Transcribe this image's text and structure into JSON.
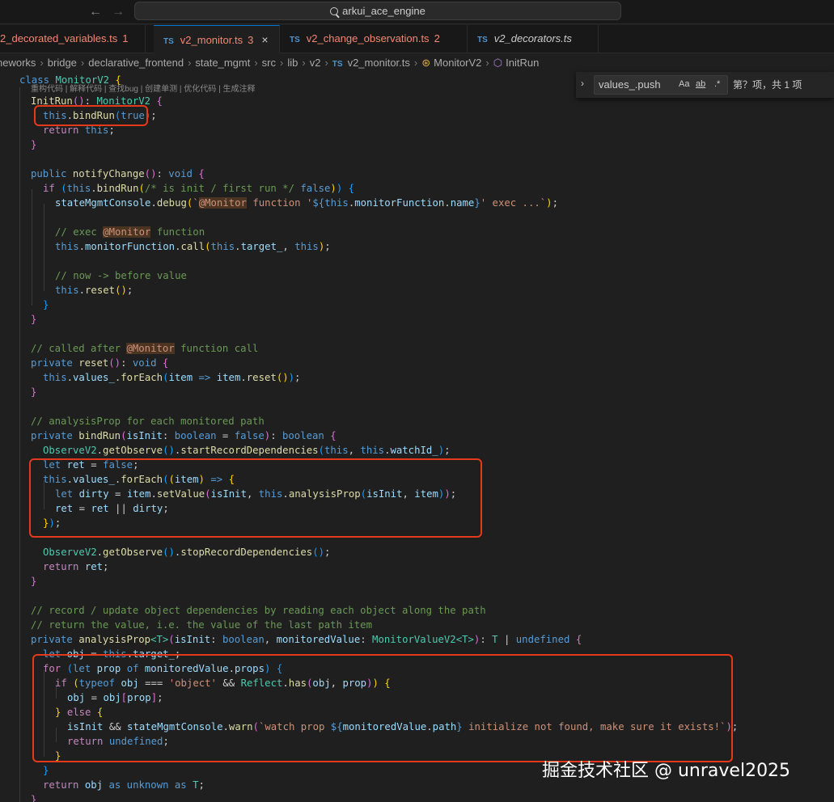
{
  "titlebar": {
    "back_icon": "arrow-left-icon",
    "forward_icon": "arrow-right-icon",
    "search_text": "arkui_ace_engine"
  },
  "tabs": [
    {
      "prefix": "",
      "name": "2_decorated_variables.ts",
      "badge": "1",
      "active": false
    },
    {
      "prefix": "TS",
      "name": "v2_monitor.ts",
      "badge": "3",
      "active": true
    },
    {
      "prefix": "TS",
      "name": "v2_change_observation.ts",
      "badge": "2",
      "active": false
    },
    {
      "prefix": "TS",
      "name": "v2_decorators.ts",
      "badge": "",
      "active": false
    }
  ],
  "breadcrumb": {
    "items": [
      "neworks",
      "bridge",
      "declarative_frontend",
      "state_mgmt",
      "src",
      "lib",
      "v2"
    ],
    "file_prefix": "TS",
    "file": "v2_monitor.ts",
    "class_name": "MonitorV2",
    "method": "InitRun"
  },
  "find": {
    "query": "values_.push",
    "opt_case": "Aa",
    "opt_word": "ab",
    "opt_regex": ".*",
    "count": "第？项，共 1 项"
  },
  "editor": {
    "codelens": "重构代码 | 解释代码 | 查找bug | 创建单测 | 优化代码 | 生成注释"
  },
  "watermark": "掘金技术社区 @ unravel2025"
}
